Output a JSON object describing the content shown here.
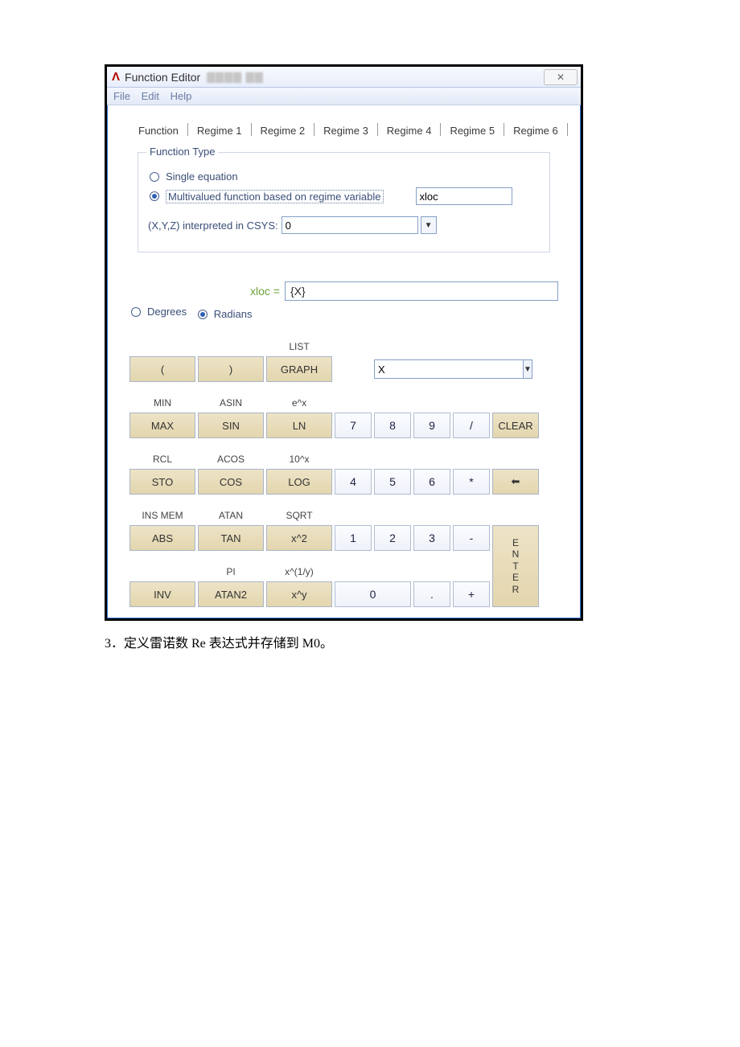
{
  "title": "Function Editor",
  "menus": {
    "file": "File",
    "edit": "Edit",
    "help": "Help"
  },
  "tabs": [
    "Function",
    "Regime 1",
    "Regime 2",
    "Regime 3",
    "Regime 4",
    "Regime 5",
    "Regime 6"
  ],
  "groupbox_legend": "Function Type",
  "radio_single": "Single equation",
  "radio_multi": "Multivalued function based on regime variable",
  "regime_var_value": "xloc",
  "csys_label": "(X,Y,Z) interpreted in CSYS:",
  "csys_value": "0",
  "expr_lhs": "xloc  =",
  "expr_value": "{X}",
  "angle": {
    "degrees": "Degrees",
    "radians": "Radians"
  },
  "toplabels": {
    "list": "LIST"
  },
  "xdd_value": "X",
  "buttons": {
    "lp": "(",
    "rp": ")",
    "graph": "GRAPH",
    "min": "MIN",
    "asin": "ASIN",
    "ex": "e^x",
    "max": "MAX",
    "sin": "SIN",
    "ln": "LN",
    "n7": "7",
    "n8": "8",
    "n9": "9",
    "div": "/",
    "clear": "CLEAR",
    "rcl": "RCL",
    "acos": "ACOS",
    "tenx": "10^x",
    "sto": "STO",
    "cos": "COS",
    "log": "LOG",
    "n4": "4",
    "n5": "5",
    "n6": "6",
    "mul": "*",
    "insmem": "INS MEM",
    "atan": "ATAN",
    "sqrt": "SQRT",
    "abs": "ABS",
    "tan": "TAN",
    "xsq": "x^2",
    "n1": "1",
    "n2": "2",
    "n3": "3",
    "minus": "-",
    "pi": "PI",
    "xroot": "x^(1/y)",
    "inv": "INV",
    "atan2": "ATAN2",
    "xy": "x^y",
    "n0": "0",
    "dot": ".",
    "plus": "+",
    "back": "⬅",
    "enter": "E\nN\nT\nE\nR"
  },
  "caption": "3．定义雷诺数 Re 表达式并存储到 M0。"
}
